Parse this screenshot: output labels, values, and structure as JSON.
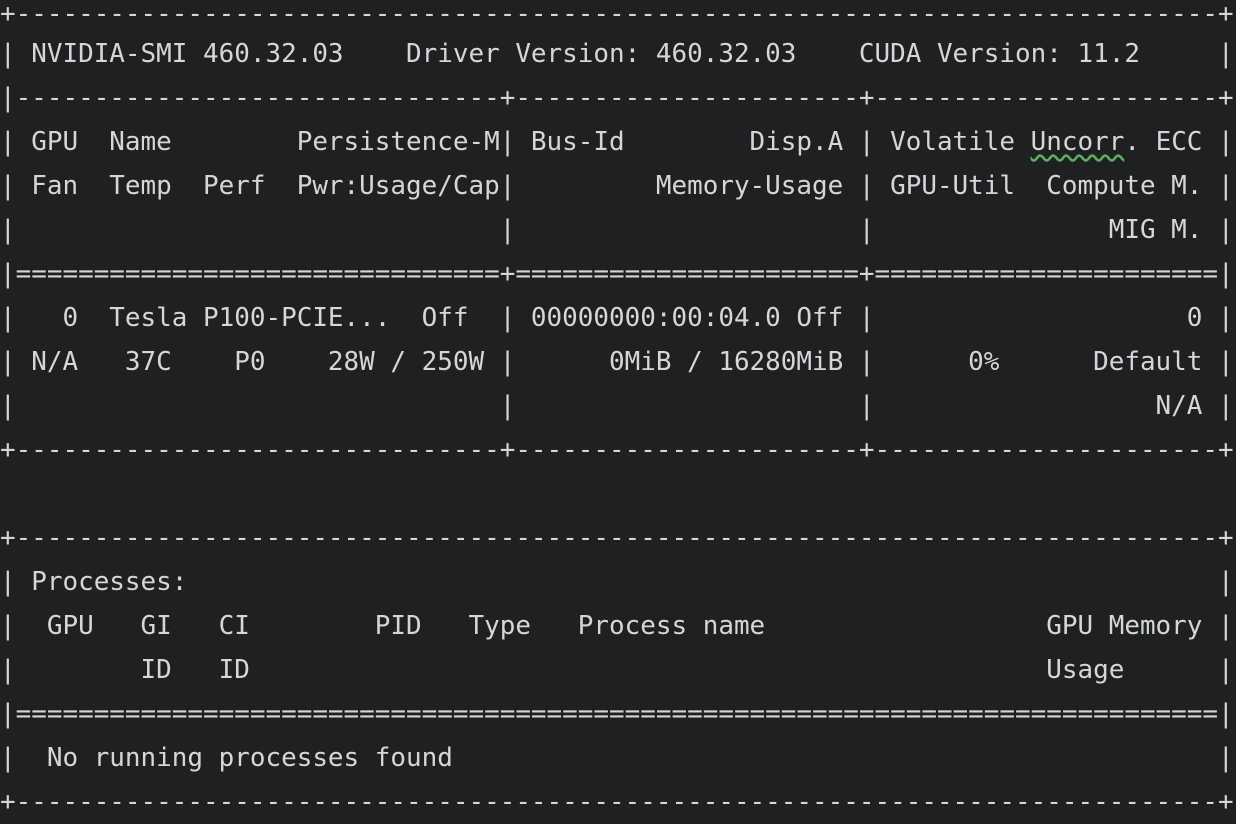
{
  "terminal": {
    "lines": [
      "+-----------------------------------------------------------------------------+",
      "| NVIDIA-SMI 460.32.03    Driver Version: 460.32.03    CUDA Version: 11.2     |",
      "|-------------------------------+----------------------+----------------------+",
      "| GPU  Name        Persistence-M| Bus-Id        Disp.A | Volatile Uncorr. ECC |",
      "| Fan  Temp  Perf  Pwr:Usage/Cap|         Memory-Usage | GPU-Util  Compute M. |",
      "|                               |                      |               MIG M. |",
      "|===============================+======================+======================|",
      "|   0  Tesla P100-PCIE...  Off  | 00000000:00:04.0 Off |                    0 |",
      "| N/A   37C    P0    28W / 250W |      0MiB / 16280MiB |      0%      Default |",
      "|                               |                      |                  N/A |",
      "+-------------------------------+----------------------+----------------------+",
      "",
      "+-----------------------------------------------------------------------------+",
      "| Processes:                                                                  |",
      "|  GPU   GI   CI        PID   Type   Process name                  GPU Memory |",
      "|        ID   ID                                                   Usage      |",
      "|=============================================================================|",
      "|  No running processes found                                                 |",
      "+-----------------------------------------------------------------------------+"
    ],
    "squiggle_word": "Uncorr",
    "colors": {
      "background": "#1f2022",
      "foreground": "#d4d6d8",
      "squiggle": "#5fae5f"
    }
  }
}
